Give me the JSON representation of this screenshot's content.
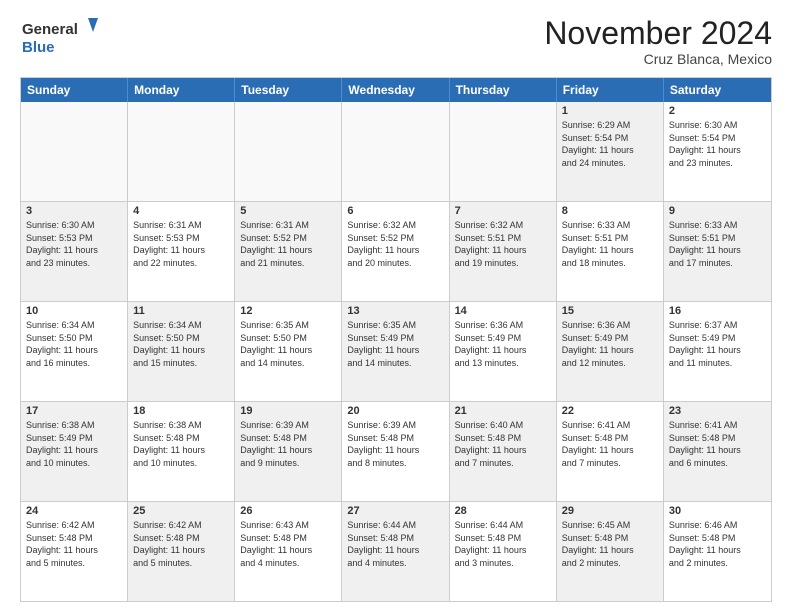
{
  "header": {
    "logo_general": "General",
    "logo_blue": "Blue",
    "month_title": "November 2024",
    "subtitle": "Cruz Blanca, Mexico"
  },
  "weekdays": [
    "Sunday",
    "Monday",
    "Tuesday",
    "Wednesday",
    "Thursday",
    "Friday",
    "Saturday"
  ],
  "rows": [
    [
      {
        "day": "",
        "info": "",
        "empty": true
      },
      {
        "day": "",
        "info": "",
        "empty": true
      },
      {
        "day": "",
        "info": "",
        "empty": true
      },
      {
        "day": "",
        "info": "",
        "empty": true
      },
      {
        "day": "",
        "info": "",
        "empty": true
      },
      {
        "day": "1",
        "info": "Sunrise: 6:29 AM\nSunset: 5:54 PM\nDaylight: 11 hours\nand 24 minutes.",
        "shaded": true
      },
      {
        "day": "2",
        "info": "Sunrise: 6:30 AM\nSunset: 5:54 PM\nDaylight: 11 hours\nand 23 minutes.",
        "shaded": false
      }
    ],
    [
      {
        "day": "3",
        "info": "Sunrise: 6:30 AM\nSunset: 5:53 PM\nDaylight: 11 hours\nand 23 minutes.",
        "shaded": true
      },
      {
        "day": "4",
        "info": "Sunrise: 6:31 AM\nSunset: 5:53 PM\nDaylight: 11 hours\nand 22 minutes.",
        "shaded": false
      },
      {
        "day": "5",
        "info": "Sunrise: 6:31 AM\nSunset: 5:52 PM\nDaylight: 11 hours\nand 21 minutes.",
        "shaded": true
      },
      {
        "day": "6",
        "info": "Sunrise: 6:32 AM\nSunset: 5:52 PM\nDaylight: 11 hours\nand 20 minutes.",
        "shaded": false
      },
      {
        "day": "7",
        "info": "Sunrise: 6:32 AM\nSunset: 5:51 PM\nDaylight: 11 hours\nand 19 minutes.",
        "shaded": true
      },
      {
        "day": "8",
        "info": "Sunrise: 6:33 AM\nSunset: 5:51 PM\nDaylight: 11 hours\nand 18 minutes.",
        "shaded": false
      },
      {
        "day": "9",
        "info": "Sunrise: 6:33 AM\nSunset: 5:51 PM\nDaylight: 11 hours\nand 17 minutes.",
        "shaded": true
      }
    ],
    [
      {
        "day": "10",
        "info": "Sunrise: 6:34 AM\nSunset: 5:50 PM\nDaylight: 11 hours\nand 16 minutes.",
        "shaded": false
      },
      {
        "day": "11",
        "info": "Sunrise: 6:34 AM\nSunset: 5:50 PM\nDaylight: 11 hours\nand 15 minutes.",
        "shaded": true
      },
      {
        "day": "12",
        "info": "Sunrise: 6:35 AM\nSunset: 5:50 PM\nDaylight: 11 hours\nand 14 minutes.",
        "shaded": false
      },
      {
        "day": "13",
        "info": "Sunrise: 6:35 AM\nSunset: 5:49 PM\nDaylight: 11 hours\nand 14 minutes.",
        "shaded": true
      },
      {
        "day": "14",
        "info": "Sunrise: 6:36 AM\nSunset: 5:49 PM\nDaylight: 11 hours\nand 13 minutes.",
        "shaded": false
      },
      {
        "day": "15",
        "info": "Sunrise: 6:36 AM\nSunset: 5:49 PM\nDaylight: 11 hours\nand 12 minutes.",
        "shaded": true
      },
      {
        "day": "16",
        "info": "Sunrise: 6:37 AM\nSunset: 5:49 PM\nDaylight: 11 hours\nand 11 minutes.",
        "shaded": false
      }
    ],
    [
      {
        "day": "17",
        "info": "Sunrise: 6:38 AM\nSunset: 5:49 PM\nDaylight: 11 hours\nand 10 minutes.",
        "shaded": true
      },
      {
        "day": "18",
        "info": "Sunrise: 6:38 AM\nSunset: 5:48 PM\nDaylight: 11 hours\nand 10 minutes.",
        "shaded": false
      },
      {
        "day": "19",
        "info": "Sunrise: 6:39 AM\nSunset: 5:48 PM\nDaylight: 11 hours\nand 9 minutes.",
        "shaded": true
      },
      {
        "day": "20",
        "info": "Sunrise: 6:39 AM\nSunset: 5:48 PM\nDaylight: 11 hours\nand 8 minutes.",
        "shaded": false
      },
      {
        "day": "21",
        "info": "Sunrise: 6:40 AM\nSunset: 5:48 PM\nDaylight: 11 hours\nand 7 minutes.",
        "shaded": true
      },
      {
        "day": "22",
        "info": "Sunrise: 6:41 AM\nSunset: 5:48 PM\nDaylight: 11 hours\nand 7 minutes.",
        "shaded": false
      },
      {
        "day": "23",
        "info": "Sunrise: 6:41 AM\nSunset: 5:48 PM\nDaylight: 11 hours\nand 6 minutes.",
        "shaded": true
      }
    ],
    [
      {
        "day": "24",
        "info": "Sunrise: 6:42 AM\nSunset: 5:48 PM\nDaylight: 11 hours\nand 5 minutes.",
        "shaded": false
      },
      {
        "day": "25",
        "info": "Sunrise: 6:42 AM\nSunset: 5:48 PM\nDaylight: 11 hours\nand 5 minutes.",
        "shaded": true
      },
      {
        "day": "26",
        "info": "Sunrise: 6:43 AM\nSunset: 5:48 PM\nDaylight: 11 hours\nand 4 minutes.",
        "shaded": false
      },
      {
        "day": "27",
        "info": "Sunrise: 6:44 AM\nSunset: 5:48 PM\nDaylight: 11 hours\nand 4 minutes.",
        "shaded": true
      },
      {
        "day": "28",
        "info": "Sunrise: 6:44 AM\nSunset: 5:48 PM\nDaylight: 11 hours\nand 3 minutes.",
        "shaded": false
      },
      {
        "day": "29",
        "info": "Sunrise: 6:45 AM\nSunset: 5:48 PM\nDaylight: 11 hours\nand 2 minutes.",
        "shaded": true
      },
      {
        "day": "30",
        "info": "Sunrise: 6:46 AM\nSunset: 5:48 PM\nDaylight: 11 hours\nand 2 minutes.",
        "shaded": false
      }
    ]
  ]
}
